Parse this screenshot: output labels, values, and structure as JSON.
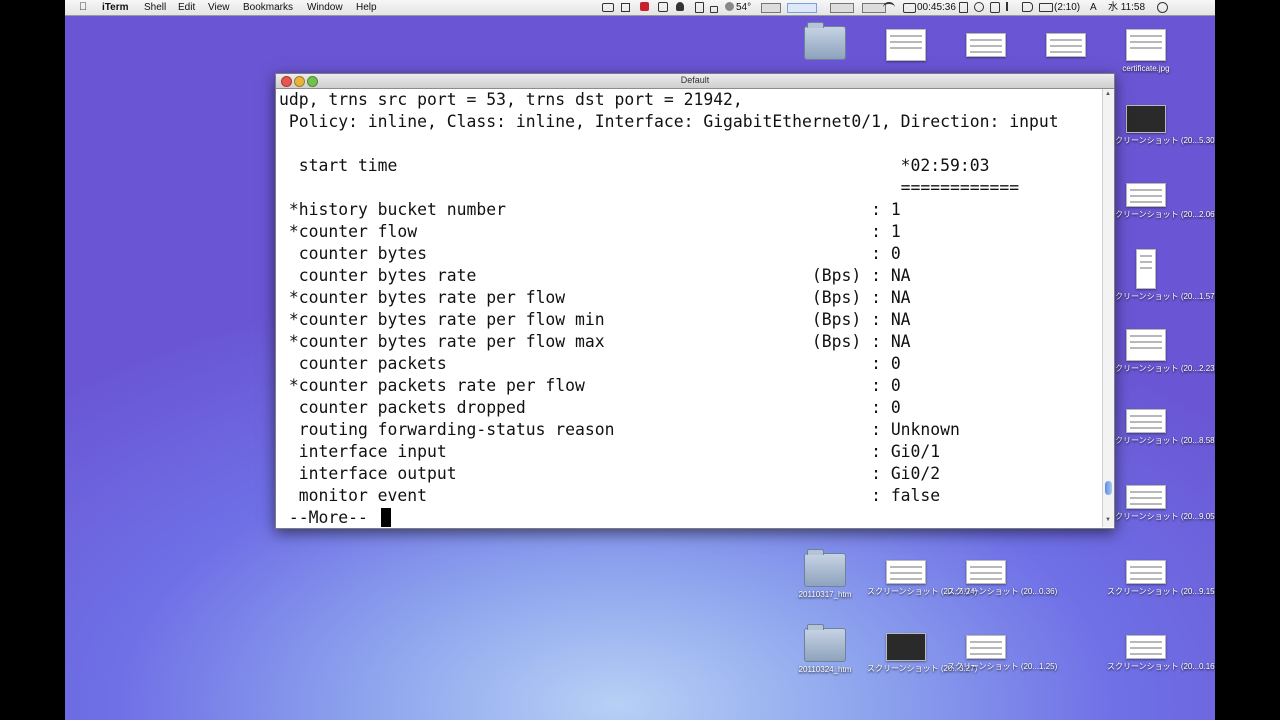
{
  "menubar": {
    "app_name": "iTerm",
    "menus": [
      "Shell",
      "Edit",
      "View",
      "Bookmarks",
      "Window",
      "Help"
    ],
    "temperature": "54°",
    "timer": "00:45:36",
    "battery": "(2:10)",
    "input_mode": "A",
    "clock": "水 11:58"
  },
  "terminal": {
    "title": "Default",
    "lines": [
      "udp, trns src port = 53, trns dst port = 21942,",
      " Policy: inline, Class: inline, Interface: GigabitEthernet0/1, Direction: input",
      "",
      "  start time                                                   *02:59:03",
      "                                                               ============",
      " *history bucket number                                     : 1",
      " *counter flow                                              : 1",
      "  counter bytes                                             : 0",
      "  counter bytes rate                                  (Bps) : NA",
      " *counter bytes rate per flow                         (Bps) : NA",
      " *counter bytes rate per flow min                     (Bps) : NA",
      " *counter bytes rate per flow max                     (Bps) : NA",
      "  counter packets                                           : 0",
      " *counter packets rate per flow                             : 0",
      "  counter packets dropped                                   : 0",
      "  routing forwarding-status reason                          : Unknown",
      "  interface input                                           : Gi0/1",
      "  interface output                                          : Gi0/2",
      "  monitor event                                             : false",
      " --More-- "
    ]
  },
  "desktop_icons": [
    {
      "label": "",
      "kind": "folder",
      "col": 0,
      "row": 0
    },
    {
      "label": "",
      "kind": "doc",
      "col": 1,
      "row": 0
    },
    {
      "label": "",
      "kind": "wide",
      "col": 2,
      "row": 0
    },
    {
      "label": "",
      "kind": "wide",
      "col": 3,
      "row": 0
    },
    {
      "label": "certificate.jpg",
      "kind": "doc",
      "col": 4,
      "row": 0
    },
    {
      "label": "スクリーンショット (20...5.30)",
      "kind": "dark",
      "col": 4,
      "row": 1
    },
    {
      "label": "スクリーンショット (20...2.06)",
      "kind": "wide",
      "col": 4,
      "row": 2
    },
    {
      "label": "スクリーンショット (20...1.57)",
      "kind": "tall",
      "col": 4,
      "row": 3
    },
    {
      "label": "スクリーンショット (20...2.23)",
      "kind": "doc",
      "col": 4,
      "row": 4
    },
    {
      "label": "スクリーンショット (20...8.58)",
      "kind": "wide",
      "col": 4,
      "row": 5
    },
    {
      "label": "スクリーンショット (20...0.54)",
      "kind": "wide",
      "col": 1,
      "row": 6
    },
    {
      "label": "スクリーンショット (20...0.30)",
      "kind": "wide",
      "col": 2,
      "row": 6
    },
    {
      "label": "スクリーンショット (20...9.05)",
      "kind": "wide",
      "col": 4,
      "row": 6
    },
    {
      "label": "20110317_htm",
      "kind": "folder",
      "col": 0,
      "row": 7
    },
    {
      "label": "スクリーンショット (20...6.24)",
      "kind": "wide",
      "col": 1,
      "row": 7
    },
    {
      "label": "スクリーンショット (20...0.36)",
      "kind": "wide",
      "col": 2,
      "row": 7
    },
    {
      "label": "スクリーンショット (20...9.15)",
      "kind": "wide",
      "col": 4,
      "row": 7
    },
    {
      "label": "20110324_htm",
      "kind": "folder",
      "col": 0,
      "row": 8
    },
    {
      "label": "スクリーンショット (20...3.27)",
      "kind": "dark",
      "col": 1,
      "row": 8
    },
    {
      "label": "スクリーンショット (20...1.25)",
      "kind": "wide",
      "col": 2,
      "row": 8
    },
    {
      "label": "スクリーンショット (20...0.16)",
      "kind": "wide",
      "col": 4,
      "row": 8
    }
  ]
}
